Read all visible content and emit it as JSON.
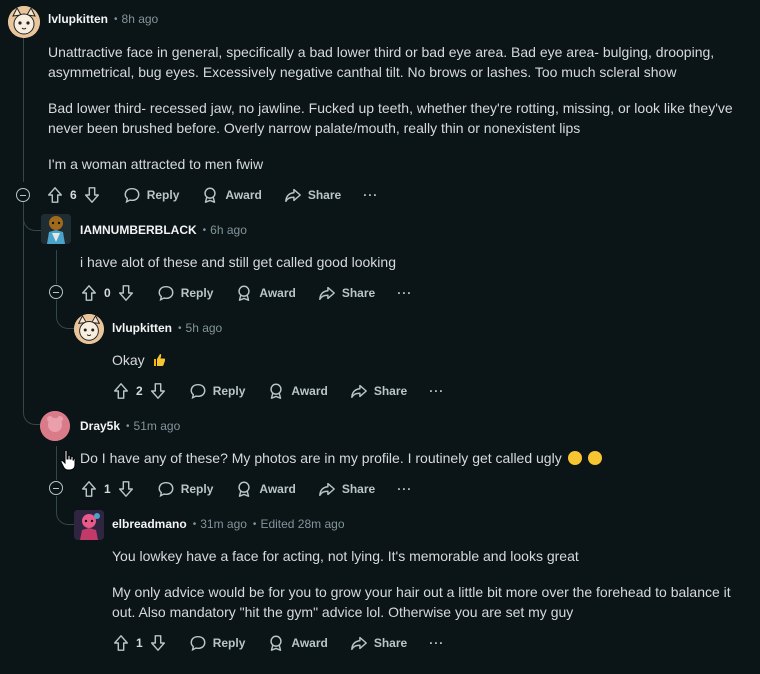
{
  "comments": [
    {
      "author": "lvlupkitten",
      "time": "8h ago",
      "paragraphs": [
        "Unattractive face in general, specifically a bad lower third or bad eye area. Bad eye area- bulging, drooping, asymmetrical, bug eyes. Excessively negative canthal tilt. No brows or lashes. Too much scleral show",
        "Bad lower third- recessed jaw, no jawline. Fucked up teeth, whether they're rotting, missing, or look like they've never been brushed before. Overly narrow palate/mouth, really thin or nonexistent lips",
        "I'm a woman attracted to men fwiw"
      ],
      "votes": "6"
    },
    {
      "author": "IAMNUMBERBLACK",
      "time": "6h ago",
      "text": "i have alot of these and still get called good looking",
      "votes": "0"
    },
    {
      "author": "lvlupkitten",
      "time": "5h ago",
      "text": "Okay",
      "votes": "2"
    },
    {
      "author": "Dray5k",
      "time": "51m ago",
      "text": "Do I have any of these? My photos are in my profile. I routinely get called ugly",
      "votes": "1"
    },
    {
      "author": "elbreadmano",
      "time": "31m ago",
      "edited": "Edited 28m ago",
      "paragraphs": [
        "You lowkey have a face for acting, not lying. It's memorable and looks great",
        "My only advice would be for you to grow your hair out a little bit more over the forehead to balance it out. Also mandatory \"hit the gym\" advice lol. Otherwise you are set my guy"
      ],
      "votes": "1"
    }
  ],
  "labels": {
    "reply": "Reply",
    "award": "Award",
    "share": "Share",
    "more": "···"
  },
  "colors": {
    "background": "#0b1416",
    "thread_line": "#33464c",
    "text": "#d7dadc",
    "meta": "#82959b"
  }
}
